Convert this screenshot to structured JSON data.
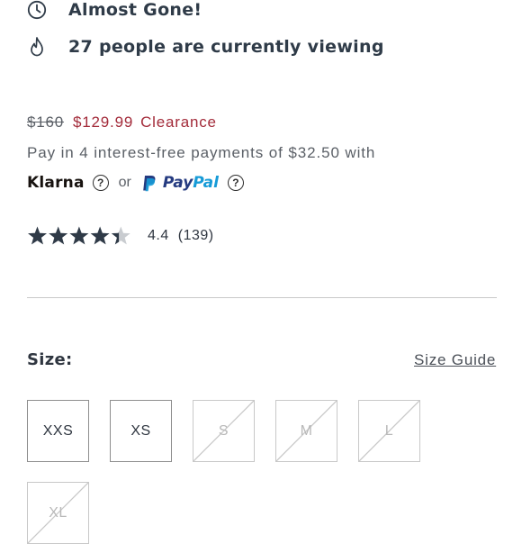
{
  "alerts": {
    "almost_gone": "Almost Gone!",
    "viewers": "27 people are currently viewing"
  },
  "price": {
    "original": "$160",
    "sale": "$129.99",
    "tag": "Clearance"
  },
  "installments": {
    "text": "Pay in 4 interest-free payments of $32.50 with",
    "klarna": "Klarna",
    "or": "or",
    "paypal_a": "Pay",
    "paypal_b": "Pal",
    "help_glyph": "?"
  },
  "rating": {
    "value": "4.4",
    "count": "(139)",
    "stars_fraction": 0.88
  },
  "size": {
    "label": "Size:",
    "guide": "Size Guide",
    "options": [
      "XXS",
      "XS",
      "S",
      "M",
      "L",
      "XL"
    ]
  },
  "colors": {
    "sale_red": "#a32b3a",
    "star": "#2f3a47",
    "star_empty": "#c9ccd0"
  }
}
